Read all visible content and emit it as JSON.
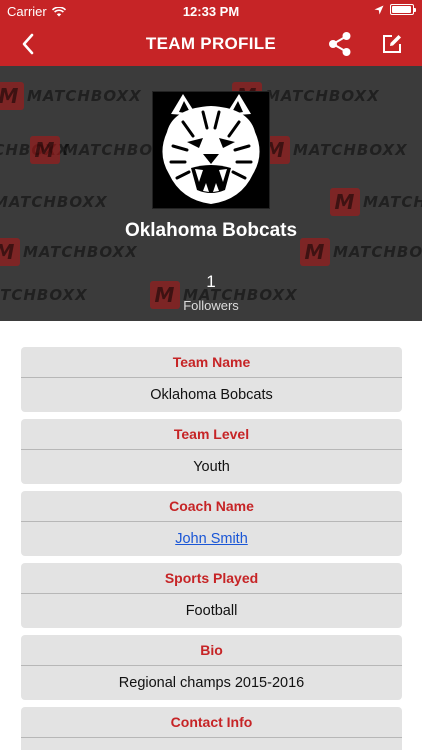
{
  "status_bar": {
    "carrier": "Carrier",
    "time": "12:33 PM",
    "battery_level": 0.95
  },
  "nav": {
    "title": "TEAM PROFILE",
    "back_icon": "chevron-left-icon",
    "share_icon": "share-icon",
    "edit_icon": "edit-icon"
  },
  "header": {
    "watermark_text": "MATCHBOXX",
    "team_name": "Oklahoma Bobcats",
    "followers_count": "1",
    "followers_label": "Followers"
  },
  "fields": [
    {
      "label": "Team Name",
      "value": "Oklahoma Bobcats"
    },
    {
      "label": "Team Level",
      "value": "Youth"
    },
    {
      "label": "Coach Name",
      "value": "John Smith",
      "link": true
    },
    {
      "label": "Sports Played",
      "value": "Football"
    },
    {
      "label": "Bio",
      "value": "Regional champs 2015-2016"
    },
    {
      "label": "Contact Info",
      "value": ""
    }
  ],
  "colors": {
    "brand_red": "#c62426",
    "header_bg": "#3b3b3b",
    "card_bg": "#e3e3e3",
    "link_blue": "#1a56d6"
  }
}
